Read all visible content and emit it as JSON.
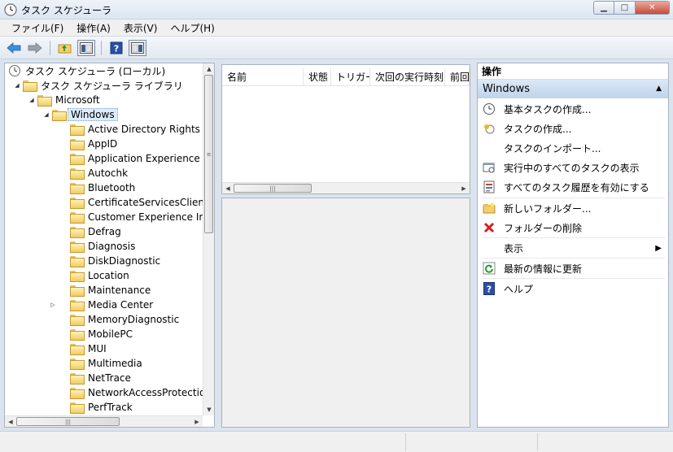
{
  "window": {
    "title": "タスク スケジューラ",
    "minimize_glyph": "▁",
    "maximize_glyph": "□",
    "close_glyph": "✕"
  },
  "menu": [
    "ファイル(F)",
    "操作(A)",
    "表示(V)",
    "ヘルプ(H)"
  ],
  "toolbar": [
    "back-icon",
    "forward-icon",
    "up-folder-icon",
    "show-hide-tree-icon",
    "help-icon",
    "show-hide-action-pane-icon"
  ],
  "tree": {
    "root": "タスク スケジューラ (ローカル)",
    "library": "タスク スケジューラ ライブラリ",
    "microsoft": "Microsoft",
    "windows": "Windows",
    "children": [
      "Active Directory Rights M",
      "AppID",
      "Application Experience",
      "Autochk",
      "Bluetooth",
      "CertificateServicesClient",
      "Customer Experience Im",
      "Defrag",
      "Diagnosis",
      "DiskDiagnostic",
      "Location",
      "Maintenance",
      "Media Center",
      "MemoryDiagnostic",
      "MobilePC",
      "MUI",
      "Multimedia",
      "NetTrace",
      "NetworkAccessProtectio",
      "PerfTrack"
    ]
  },
  "list": {
    "columns": [
      "名前",
      "状態",
      "トリガー",
      "次回の実行時刻",
      "前回"
    ]
  },
  "actions": {
    "title": "操作",
    "group": "Windows",
    "items": [
      "基本タスクの作成...",
      "タスクの作成...",
      "タスクのインポート...",
      "実行中のすべてのタスクの表示",
      "すべてのタスク履歴を有効にする",
      "新しいフォルダー...",
      "フォルダーの削除",
      "表示",
      "最新の情報に更新",
      "ヘルプ"
    ]
  },
  "colors": {
    "accent": "#3a7bd5",
    "delete": "#d42020",
    "help": "#2b4fa8"
  }
}
